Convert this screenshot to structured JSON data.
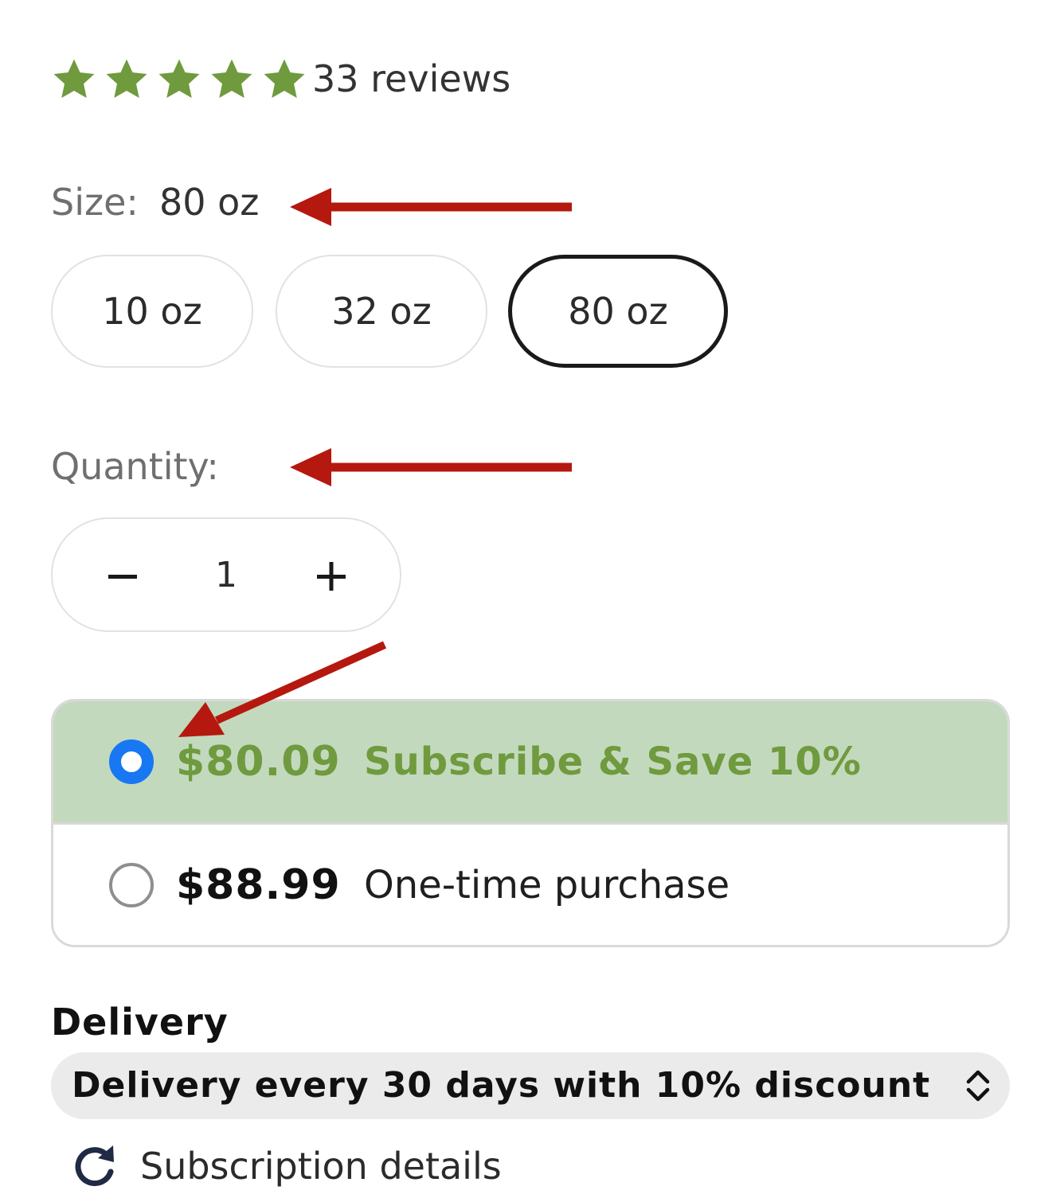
{
  "rating": {
    "stars": 5,
    "max_stars": 5,
    "star_color": "#6f9a3e",
    "reviews_label": "33 reviews"
  },
  "size": {
    "label": "Size:",
    "selected": "80 oz",
    "options": [
      "10 oz",
      "32 oz",
      "80 oz"
    ]
  },
  "quantity": {
    "label": "Quantity:",
    "value": "1",
    "decrement_icon": "minus-icon",
    "increment_icon": "plus-icon"
  },
  "purchase_options": {
    "subscribe": {
      "price": "$80.09",
      "label": "Subscribe & Save 10%",
      "selected": true,
      "background": "#c3d9bd",
      "accent": "#6f9a3e"
    },
    "one_time": {
      "price": "$88.99",
      "label": "One-time purchase",
      "selected": false
    },
    "radio_color": "#1877f2"
  },
  "delivery": {
    "title": "Delivery",
    "selected_option": "Delivery every 30 days with 10% discount",
    "select_icon": "chevron-up-down-icon"
  },
  "subscription_details": {
    "label": "Subscription details",
    "icon": "refresh-icon"
  },
  "annotations": {
    "arrow_color": "#b5180f"
  }
}
